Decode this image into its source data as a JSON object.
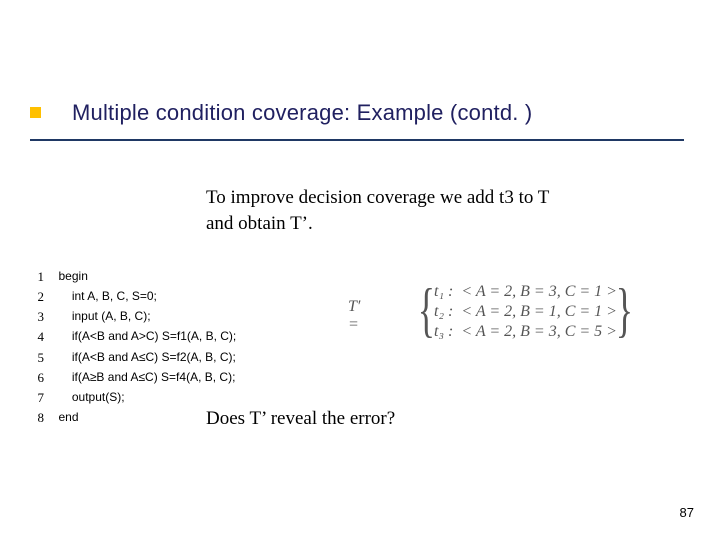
{
  "title": "Multiple condition coverage: Example (contd. )",
  "body_line1": "To improve decision coverage we add t3 to T",
  "body_line2": "and obtain T’.",
  "code": [
    {
      "n": "1",
      "t": "begin"
    },
    {
      "n": "2",
      "t": "int A, B, C, S=0;"
    },
    {
      "n": "3",
      "t": "input (A, B, C);"
    },
    {
      "n": "4",
      "t": "if(A<B and A>C) S=f1(A, B, C);"
    },
    {
      "n": "5",
      "t": "if(A<B and A≤C) S=f2(A, B, C);"
    },
    {
      "n": "6",
      "t": "if(A≥B and A≤C) S=f4(A, B, C);"
    },
    {
      "n": "7",
      "t": "output(S);"
    },
    {
      "n": "8",
      "t": "end"
    }
  ],
  "formula": {
    "lhs": "T′ =",
    "rows": [
      {
        "label": "t₁ :",
        "val": "< A = 2, B = 3, C = 1 >"
      },
      {
        "label": "t₂ :",
        "val": "< A = 2, B = 1, C = 1 >"
      },
      {
        "label": "t₃ :",
        "val": "< A = 2, B = 3, C = 5 >"
      }
    ]
  },
  "question": "Does T’ reveal the error?",
  "page": "87"
}
